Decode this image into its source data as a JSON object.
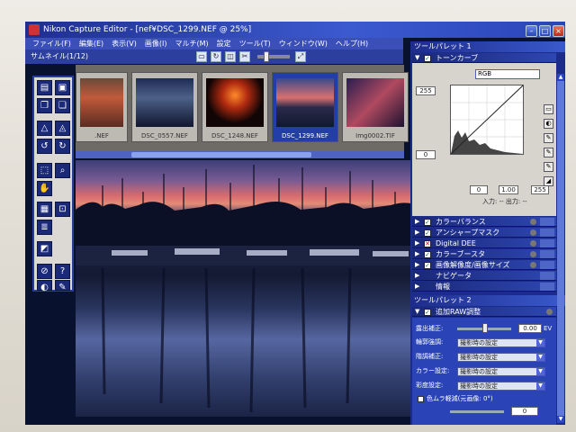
{
  "window": {
    "title": "Nikon Capture Editor - [nef¥DSC_1299.NEF @ 25%]",
    "menu": [
      "ファイル(F)",
      "編集(E)",
      "表示(V)",
      "画像(I)",
      "マルチ(M)",
      "ウィンドウ(W)",
      "設定",
      "ツール(T)",
      "ウィンドウ(W)",
      "ヘルプ(H)"
    ]
  },
  "browser": {
    "label": "サムネイル(1/12)",
    "thumbnails": [
      {
        "caption": ".NEF"
      },
      {
        "caption": "DSC_0557.NEF"
      },
      {
        "caption": "DSC_1248.NEF"
      },
      {
        "caption": "DSC_1299.NEF",
        "selected": true
      },
      {
        "caption": "Img0002.TIF"
      },
      {
        "caption": "Img0"
      }
    ]
  },
  "palette1": {
    "title": "ツールパレット 1",
    "tone_curve": {
      "label": "トーンカーブ",
      "channel": "RGB",
      "input_max": "255",
      "input_min": "0",
      "black": "0",
      "gamma": "1.00",
      "white": "255",
      "io_label": "入力: --    出力: --"
    },
    "sections": [
      {
        "label": "カラーバランス",
        "check": "✓"
      },
      {
        "label": "アンシャープマスク",
        "check": "✓"
      },
      {
        "label": "Digital DEE",
        "check": "✕"
      },
      {
        "label": "カラーブースタ",
        "check": "✓"
      },
      {
        "label": "画像解像度/画像サイズ",
        "check": "✓"
      },
      {
        "label": "ナビゲータ",
        "check": ""
      },
      {
        "label": "情報",
        "check": ""
      }
    ]
  },
  "palette2": {
    "title": "ツールパレット 2",
    "raw": {
      "label": "追加RAW調整",
      "exposure_label": "露出補正:",
      "exposure_value": "0.00",
      "exposure_unit": "EV",
      "rows": [
        {
          "label": "輪郭強調:",
          "value": "撮影時の設定"
        },
        {
          "label": "階調補正:",
          "value": "撮影時の設定"
        },
        {
          "label": "カラー設定:",
          "value": "撮影時の設定"
        },
        {
          "label": "彩度設定:",
          "value": "撮影時の設定"
        }
      ],
      "color_moire": "色ムラ軽減(元画像: 0°)",
      "moire_value": "0"
    }
  },
  "colors": {
    "accent": "#2a44b8",
    "selection": "#233ea8"
  }
}
